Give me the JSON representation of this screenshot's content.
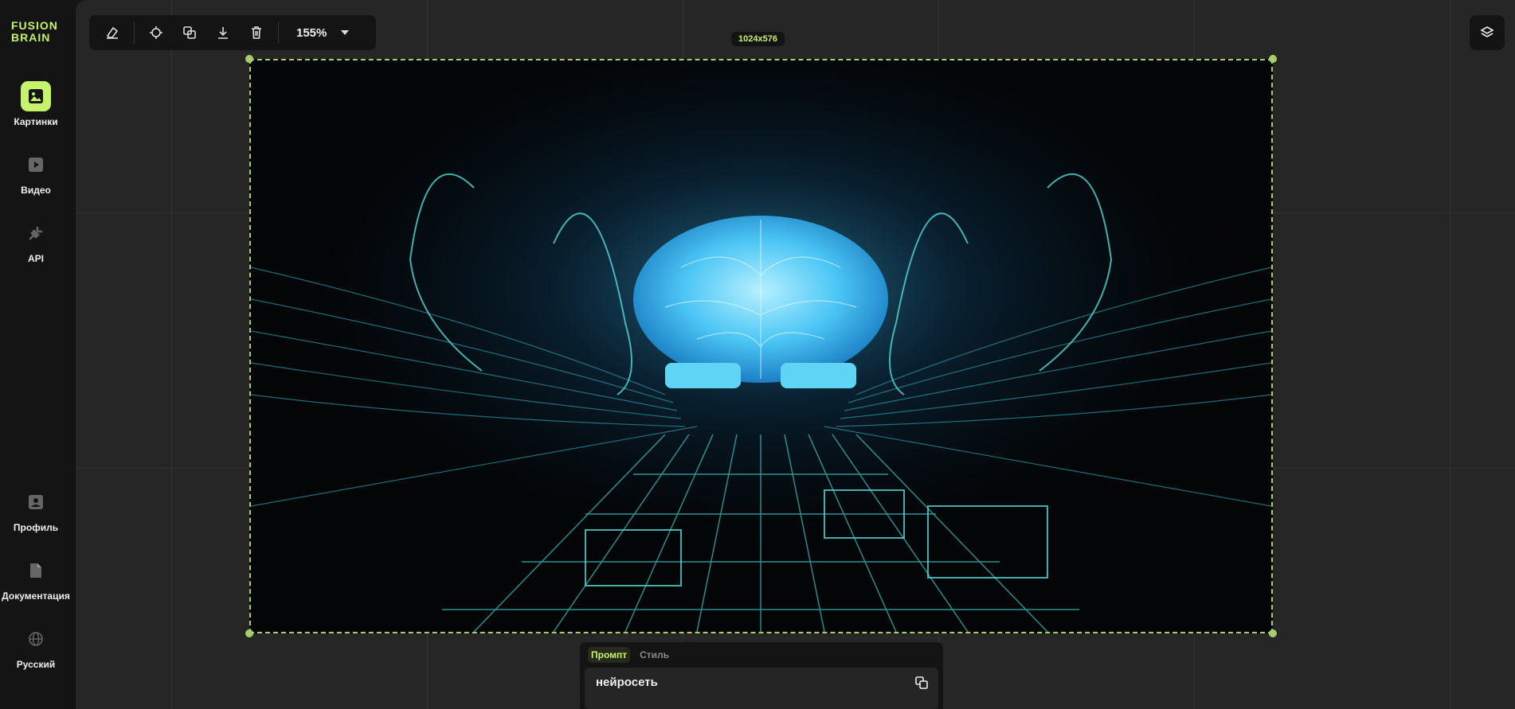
{
  "brand": {
    "logo_line1": "FUSION",
    "logo_line2": "BRAIN"
  },
  "sidebar": {
    "items": [
      {
        "label": "Картинки",
        "icon": "image-icon",
        "active": true
      },
      {
        "label": "Видео",
        "icon": "play-icon",
        "active": false
      },
      {
        "label": "API",
        "icon": "plug-icon",
        "active": false
      }
    ],
    "bottom_items": [
      {
        "label": "Профиль",
        "icon": "profile-icon"
      },
      {
        "label": "Документация",
        "icon": "document-icon"
      },
      {
        "label": "Русский",
        "icon": "globe-icon"
      }
    ]
  },
  "toolbar": {
    "tools": [
      "eraser-icon",
      "target-icon",
      "duplicate-icon",
      "download-icon",
      "trash-icon"
    ],
    "zoom": "155%"
  },
  "canvas": {
    "dimensions_label": "1024x576"
  },
  "prompt": {
    "tabs": [
      {
        "label": "Промпт",
        "active": true
      },
      {
        "label": "Стиль",
        "active": false
      }
    ],
    "text": "нейросеть"
  },
  "colors": {
    "accent": "#c6f36b",
    "frame_border": "#a6cf6b",
    "glow": "#4fd0ff",
    "grid_line": "#2fb3b0"
  }
}
